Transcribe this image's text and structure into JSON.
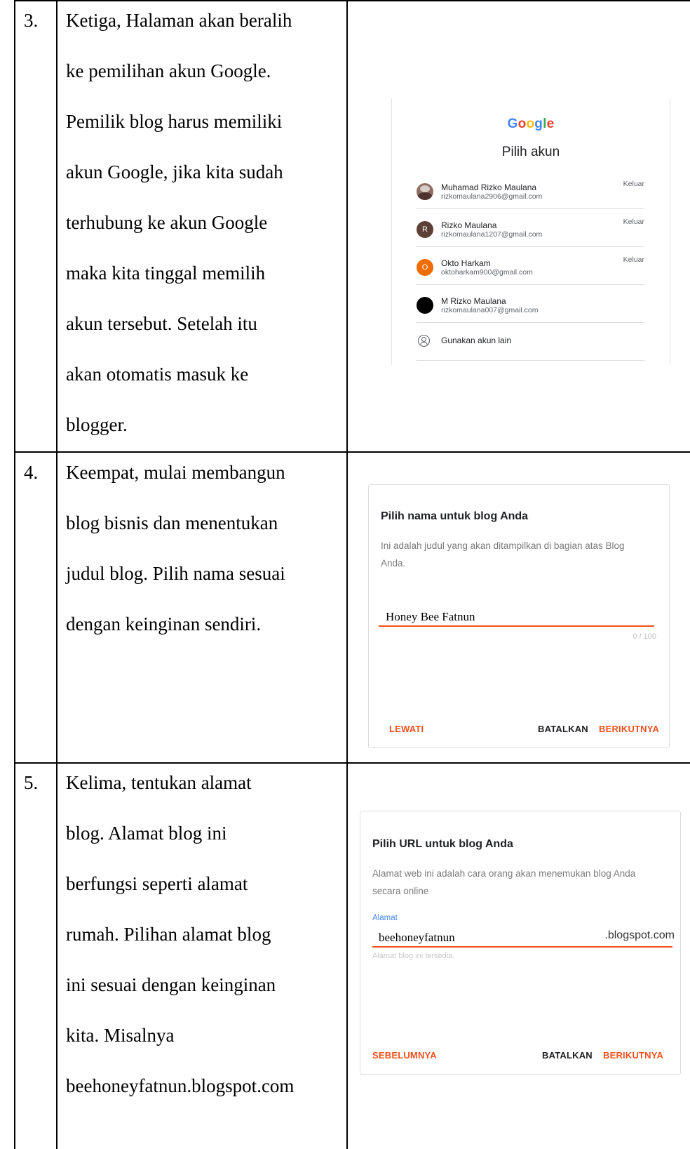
{
  "rows": [
    {
      "number": "3.",
      "lines": [
        "Ketiga, Halaman akan beralih",
        "ke pemilihan akun Google.",
        "Pemilik blog harus memiliki",
        "akun Google, jika kita sudah",
        "terhubung ke akun Google",
        "maka kita tinggal memilih",
        "akun tersebut. Setelah itu",
        "akan otomatis masuk ke",
        "blogger."
      ]
    },
    {
      "number": "4.",
      "lines": [
        "Keempat,  mulai membangun",
        "blog bisnis dan menentukan",
        "judul blog. Pilih nama sesuai",
        "dengan keinginan sendiri."
      ]
    },
    {
      "number": "5.",
      "lines": [
        "Kelima, tentukan alamat",
        "blog. Alamat blog ini",
        "berfungsi seperti alamat",
        "rumah. Pilihan alamat blog",
        "ini sesuai dengan keinginan",
        "kita. Misalnya",
        "beehoneyfatnun.blogspot.com"
      ]
    }
  ],
  "account_chooser": {
    "logo_letters": [
      "G",
      "o",
      "o",
      "g",
      "l",
      "e"
    ],
    "logo_colors": [
      "#4285f4",
      "#ea4335",
      "#fbbc05",
      "#4285f4",
      "#34a853",
      "#ea4335"
    ],
    "title": "Pilih akun",
    "accounts": [
      {
        "name": "Muhamad Rizko Maulana",
        "email": "rizkomaulana2906@gmail.com",
        "action": "Keluar",
        "avatar_letter": "",
        "avatar_color": "#8d6e63"
      },
      {
        "name": "Rizko Maulana",
        "email": "rizkomaulana1207@gmail.com",
        "action": "Keluar",
        "avatar_letter": "R",
        "avatar_color": "#5d4037"
      },
      {
        "name": "Okto Harkam",
        "email": "oktoharkam900@gmail.com",
        "action": "Keluar",
        "avatar_letter": "O",
        "avatar_color": "#ef6c00"
      },
      {
        "name": "M Rizko Maulana",
        "email": "rizkomaulana007@gmail.com",
        "action": "",
        "avatar_letter": "",
        "avatar_color": "#000000"
      }
    ],
    "other_account": "Gunakan akun lain"
  },
  "name_card": {
    "title": "Pilih nama untuk blog Anda",
    "description_lines": [
      "Ini adalah judul yang akan ditampilkan di bagian atas Blog",
      "Anda."
    ],
    "value": "Honey Bee Fatnun",
    "counter": "0 / 100",
    "skip_label": "LEWATI",
    "cancel_label": "BATALKAN",
    "next_label": "BERIKUTNYA"
  },
  "url_card": {
    "title": "Pilih URL untuk blog Anda",
    "description_lines": [
      "Alamat web ini adalah cara orang akan menemukan blog Anda",
      "secara online"
    ],
    "field_label": "Alamat",
    "value": "beehoneyfatnun",
    "suffix": ".blogspot.com",
    "hint": "Alamat blog ini tersedia.",
    "prev_label": "SEBELUMNYA",
    "cancel_label": "BATALKAN",
    "next_label": "BERIKUTNYA"
  }
}
